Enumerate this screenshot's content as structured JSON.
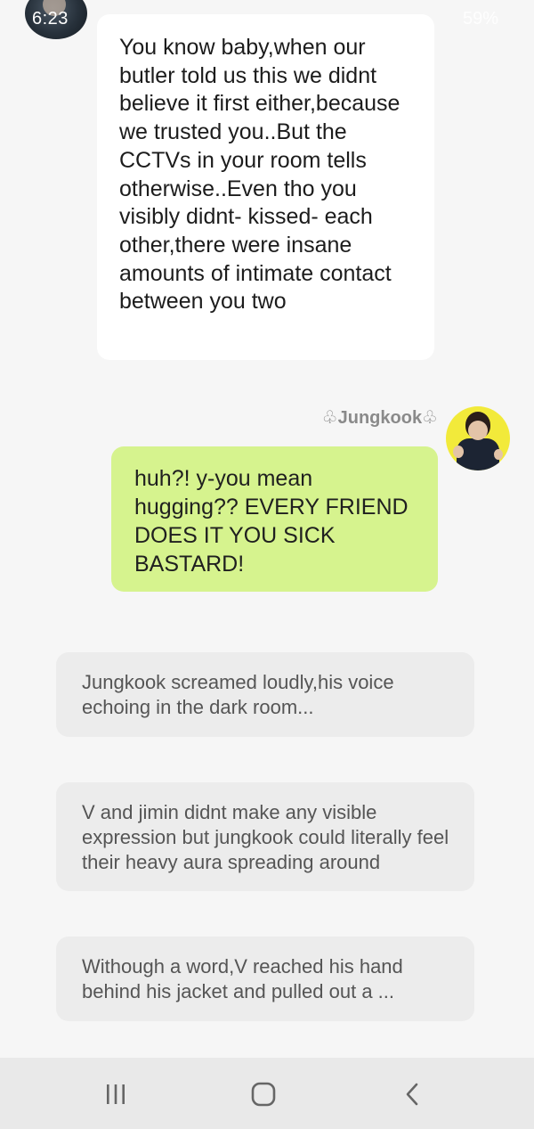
{
  "status_bar": {
    "time": "6:23",
    "battery": "59%"
  },
  "messages": [
    {
      "sender": "other",
      "text": "You know baby,when our butler told us this we didnt believe it first either,because we trusted you..But the CCTVs in your room tells otherwise..Even tho you visibly didnt- kissed- each other,there were insane amounts of intimate contact between you two"
    },
    {
      "sender": "♧Jungkook♧",
      "text": "huh?! y-you mean hugging?? EVERY FRIEND DOES IT YOU SICK BASTARD!"
    }
  ],
  "narration": [
    "Jungkook screamed loudly,his voice echoing in the dark room...",
    "V and jimin didnt make any visible expression but jungkook could literally feel their heavy aura spreading around",
    "Withough a word,V reached his hand behind his jacket and pulled out a ..."
  ],
  "colors": {
    "background": "#f6f6f6",
    "white_bubble": "#ffffff",
    "green_bubble": "#d6f38e",
    "narration_bubble": "#ececec",
    "nav_bar": "#e9e9e9"
  },
  "navbar": {
    "icons": [
      "recent-apps-icon",
      "home-icon",
      "back-icon"
    ]
  }
}
